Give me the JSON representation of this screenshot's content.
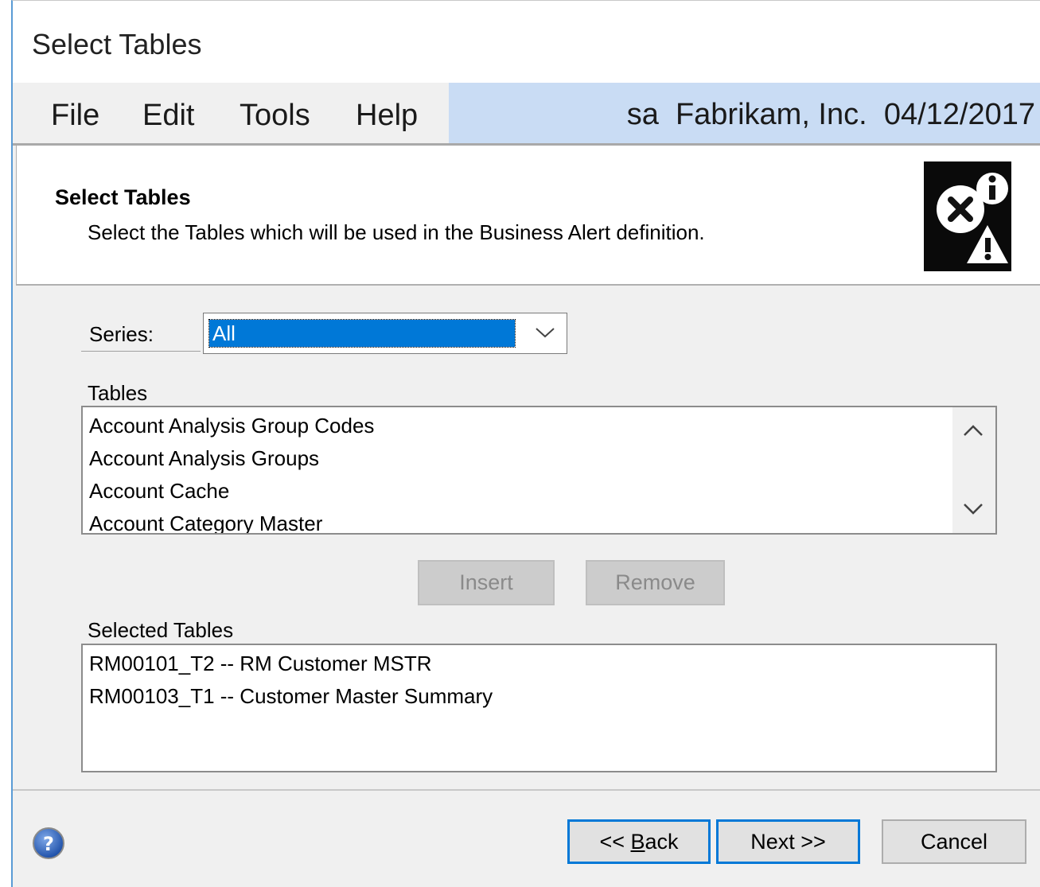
{
  "window": {
    "title": "Select Tables"
  },
  "menu": {
    "items": [
      "File",
      "Edit",
      "Tools",
      "Help"
    ],
    "status": {
      "user": "sa",
      "company": "Fabrikam, Inc.",
      "date": "04/12/2017"
    }
  },
  "header": {
    "title": "Select Tables",
    "description": "Select the Tables which will be used in the Business Alert definition.",
    "icon": "alert-info-icon"
  },
  "series": {
    "label": "Series:",
    "value": "All"
  },
  "tables": {
    "label": "Tables",
    "items": [
      "Account Analysis Group Codes",
      "Account Analysis Groups",
      "Account Cache",
      "Account Category Master"
    ]
  },
  "actions": {
    "insert": "Insert",
    "remove": "Remove"
  },
  "selected_tables": {
    "label": "Selected Tables",
    "items": [
      "RM00101_T2 -- RM Customer MSTR",
      "RM00103_T1 -- Customer Master Summary"
    ]
  },
  "footer": {
    "back_prefix": "<< ",
    "back_key": "B",
    "back_rest": "ack",
    "next": "Next >>",
    "cancel": "Cancel"
  },
  "colors": {
    "accent": "#0078d7",
    "status_bar": "#c9dcf4",
    "window_border": "#5a9bd5"
  }
}
